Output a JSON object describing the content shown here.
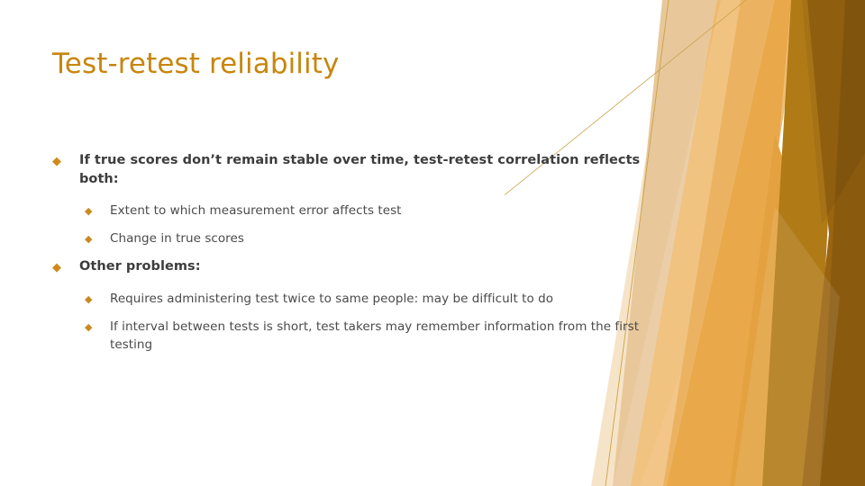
{
  "slide": {
    "title": "Test-retest reliability",
    "background_color": "#FFFFFF",
    "title_color": "#C8860D",
    "level1_text_color": "#3D3D3D",
    "level2_text_color": "#4A4A4A",
    "bullet_marker_glyph": "◆",
    "bullet_marker_color": "#D08A1A"
  },
  "content": {
    "items": [
      {
        "level": 1,
        "text": "If true scores don’t remain stable over time, test-retest correlation reflects both:"
      },
      {
        "level": 2,
        "text": "Extent to which measurement error affects test"
      },
      {
        "level": 2,
        "text": "Change in true scores"
      },
      {
        "level": 1,
        "text": "Other problems:"
      },
      {
        "level": 2,
        "text": "Requires administering test twice to same people: may be difficult to do"
      },
      {
        "level": 2,
        "text": "If interval between tests is short, test takers may remember information from the first testing"
      }
    ]
  },
  "decoration": {
    "name": "facet-theme-angular-graphic",
    "palette": {
      "light_tan": "#E8C79A",
      "pale_cream": "#F6E4C8",
      "gold": "#E9A84A",
      "gold_light": "#EFB96B",
      "amber": "#E3A23F",
      "ochre": "#B07A17",
      "dark_ochre": "#9A6410",
      "deep_brown": "#8A5A0E",
      "hairline": "#C9A24A"
    }
  }
}
